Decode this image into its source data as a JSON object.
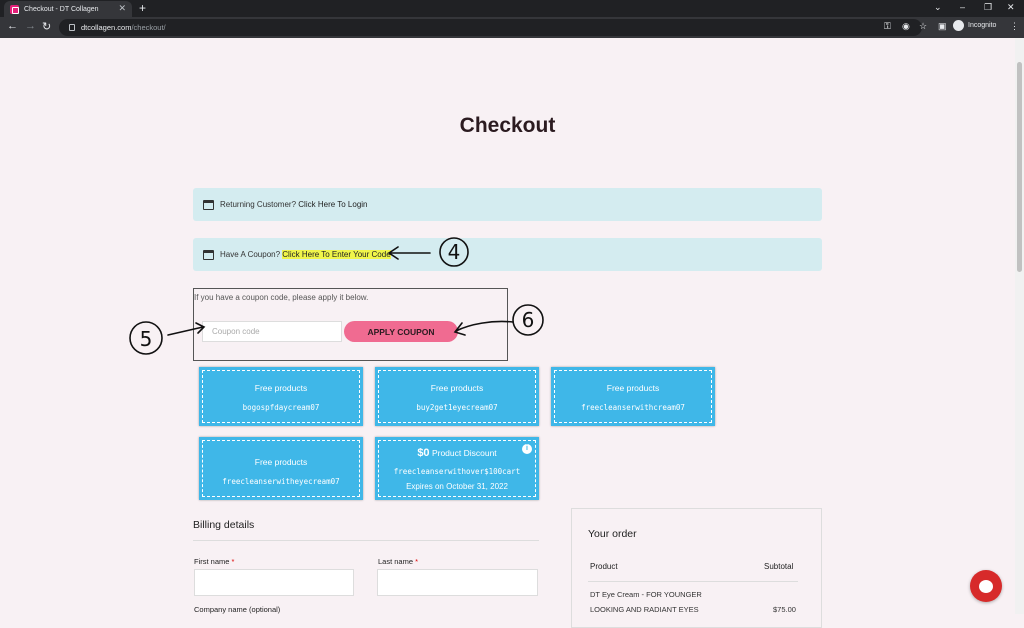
{
  "browser": {
    "tab_title": "Checkout - DT Collagen",
    "url_domain": "dtcollagen.com",
    "url_path": "/checkout/",
    "profile": "Incognito"
  },
  "page": {
    "title": "Checkout",
    "returning_customer": {
      "prefix": "Returning Customer?",
      "link": "Click Here To Login"
    },
    "coupon_notice": {
      "prefix": "Have A Coupon?",
      "link": "Click Here To Enter Your Code"
    },
    "coupon_form": {
      "hint": "If you have a coupon code, please apply it below.",
      "placeholder": "Coupon code",
      "apply_label": "APPLY COUPON"
    },
    "coupons": [
      {
        "title": "Free products",
        "code": "bogospfdaycream07"
      },
      {
        "title": "Free products",
        "code": "buy2get1eyecream07"
      },
      {
        "title": "Free products",
        "code": "freecleanserwithcream07"
      },
      {
        "title": "Free products",
        "code": "freecleanserwitheyecream07"
      },
      {
        "title_amount": "$0",
        "title_rest": "Product Discount",
        "code": "freecleanserwithover$100cart",
        "expires": "Expires on October 31, 2022"
      }
    ],
    "billing": {
      "title": "Billing details",
      "first_name": "First name",
      "last_name": "Last name",
      "company": "Company name (optional)",
      "required_mark": "*"
    },
    "order": {
      "title": "Your order",
      "col_product": "Product",
      "col_subtotal": "Subtotal",
      "item_line1": "DT Eye Cream - FOR YOUNGER",
      "item_line2": "LOOKING AND RADIANT EYES",
      "item_price": "$75.00"
    }
  },
  "annotations": {
    "a4": "4",
    "a5": "5",
    "a6": "6"
  },
  "colors": {
    "accent": "#f06b91",
    "coupon": "#3fb7e8",
    "notice": "#d4ecf0",
    "highlight": "#f0f54a"
  }
}
